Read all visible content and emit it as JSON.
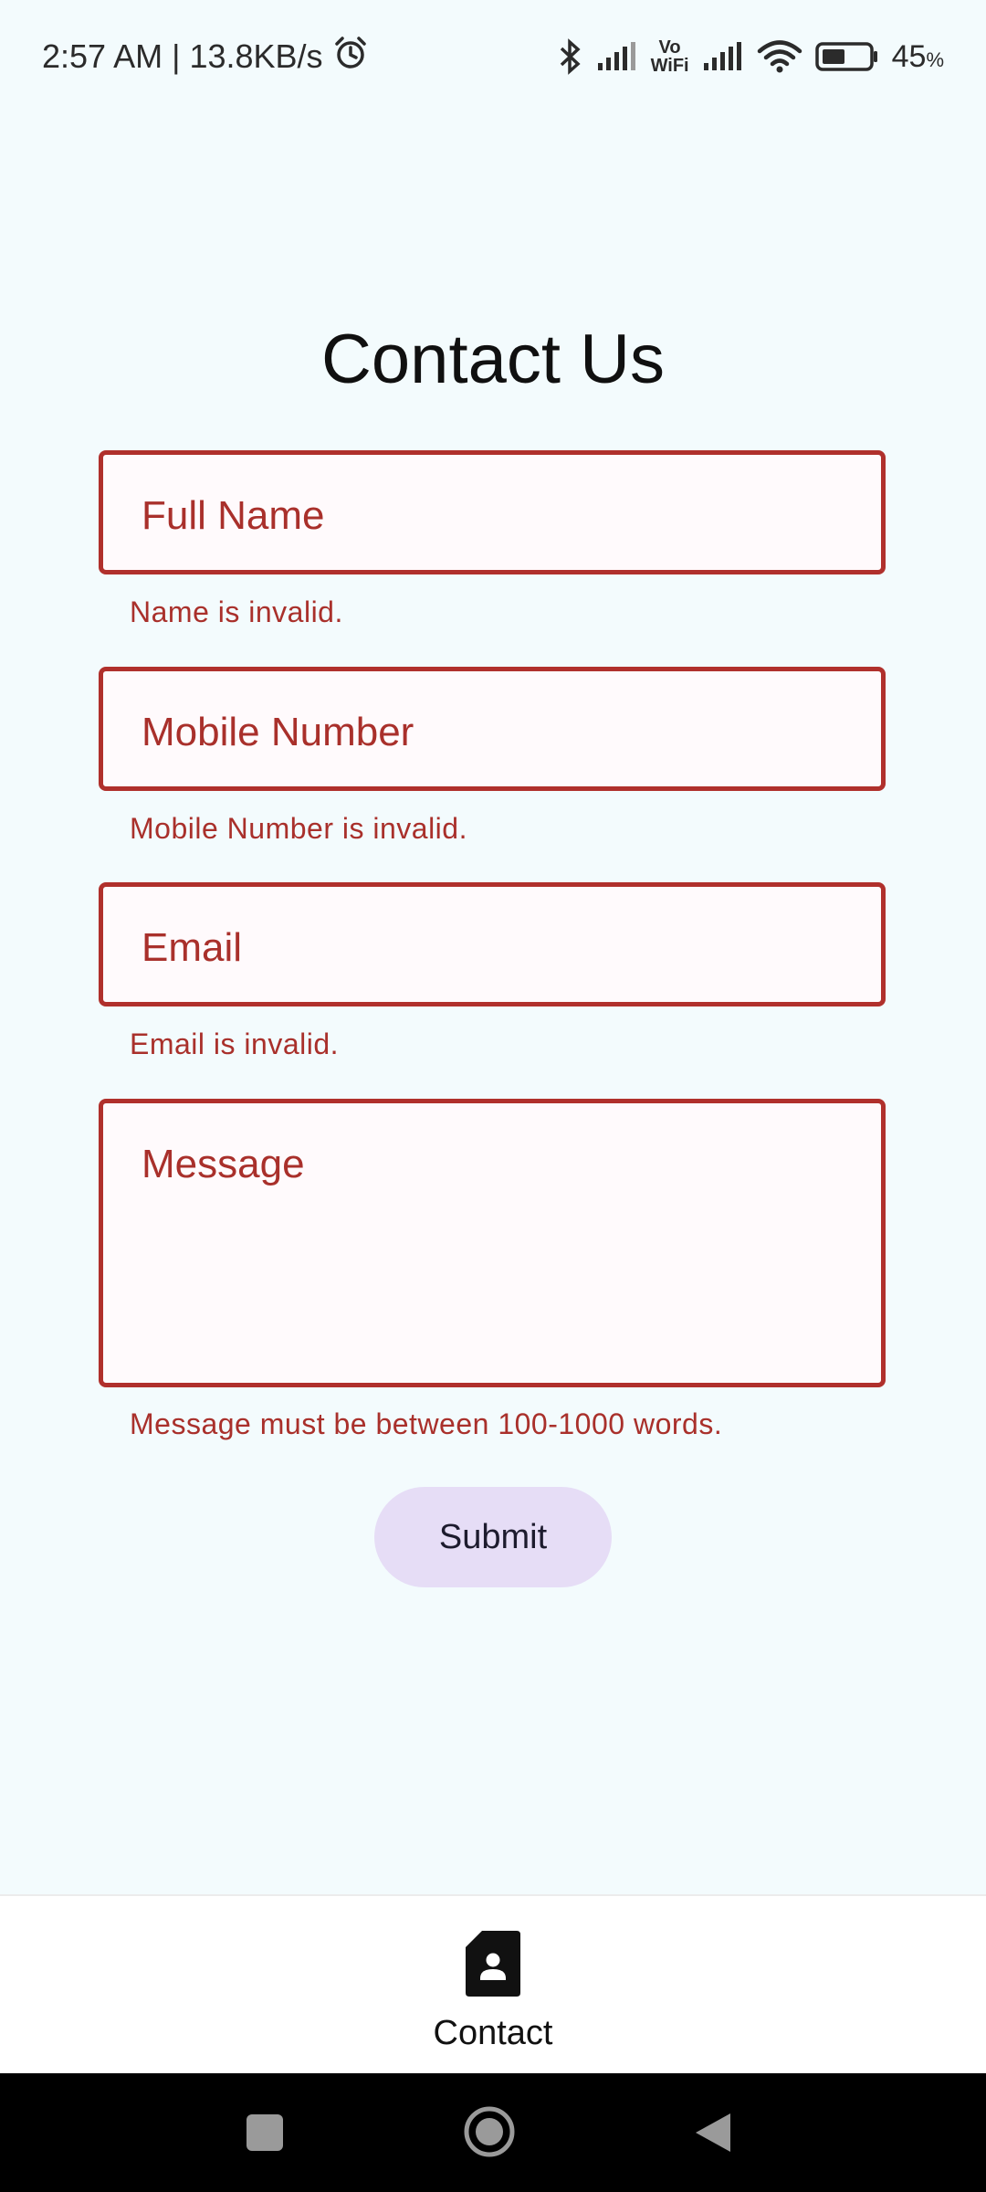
{
  "status_bar": {
    "time_speed": "2:57 AM | 13.8KB/s",
    "vowifi_top": "Vo",
    "vowifi_bottom": "WiFi",
    "battery": "45",
    "battery_unit": "%",
    "icons": [
      "alarm-icon",
      "bluetooth-icon",
      "signal-icon",
      "wifi-icon",
      "battery-icon"
    ]
  },
  "page": {
    "title": "Contact Us"
  },
  "form": {
    "full_name": {
      "placeholder": "Full Name",
      "error": "Name is invalid."
    },
    "mobile": {
      "placeholder": "Mobile Number",
      "error": "Mobile Number is invalid."
    },
    "email": {
      "placeholder": "Email",
      "error": "Email is invalid."
    },
    "message": {
      "placeholder": "Message",
      "error": "Message must be between 100-1000 words."
    },
    "submit_label": "Submit"
  },
  "bottom_nav": {
    "items": [
      {
        "label": "Contact",
        "icon": "contact-page-icon"
      }
    ]
  },
  "system_nav": {
    "icons": [
      "recents-icon",
      "home-icon",
      "back-icon"
    ]
  },
  "colors": {
    "background": "#f3fbfd",
    "error": "#b0302c",
    "button": "#e6ddf6"
  }
}
